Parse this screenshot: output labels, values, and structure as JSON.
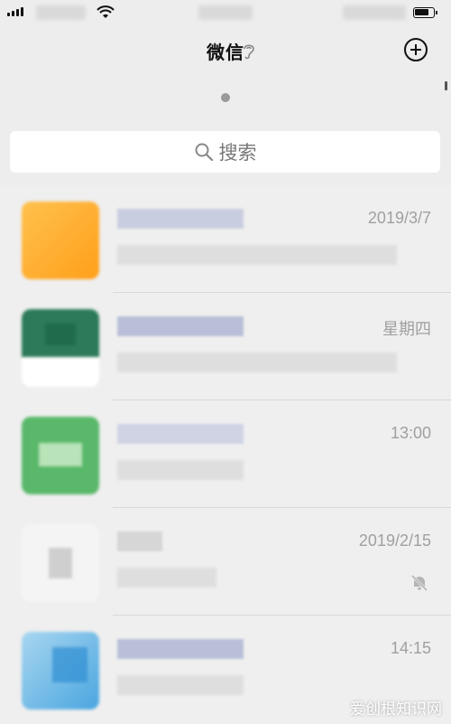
{
  "header": {
    "title": "微信"
  },
  "search": {
    "label": "搜索"
  },
  "chats": [
    {
      "time": "2019/3/7",
      "name_color": "#c9cde0",
      "avatar": "orange",
      "muted": false
    },
    {
      "time": "星期四",
      "name_color": "#b9bfd8",
      "avatar": "green-dark",
      "muted": false
    },
    {
      "time": "13:00",
      "name_color": "#cfd3e4",
      "avatar": "green",
      "muted": false
    },
    {
      "time": "2019/2/15",
      "name_color": "#d6d6d6",
      "avatar": "gray",
      "muted": true
    },
    {
      "time": "14:15",
      "name_color": "#b9bfd8",
      "avatar": "blue",
      "muted": false
    }
  ],
  "watermark": "爱创根知识网"
}
